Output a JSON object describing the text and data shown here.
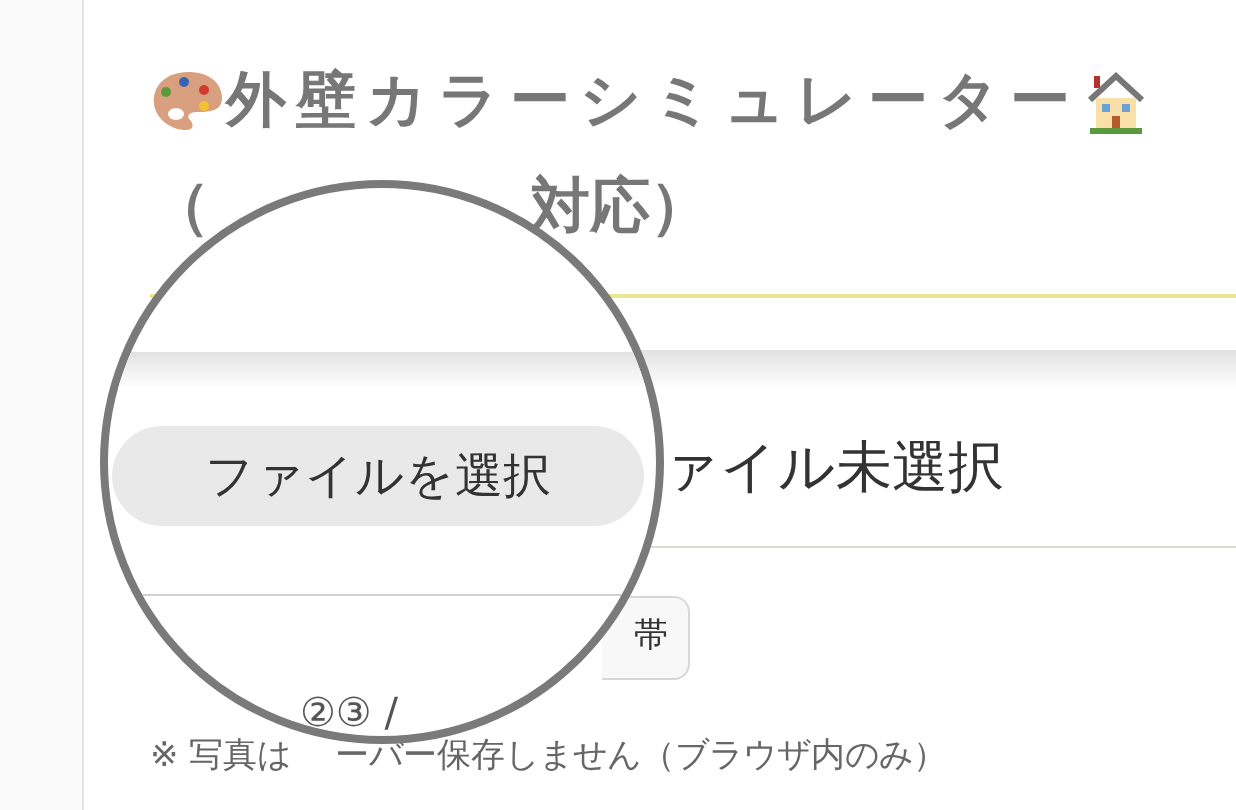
{
  "title": {
    "text": "外壁カラーシミュレーター",
    "line2_start": "（",
    "line2_end": "対応）"
  },
  "file_input": {
    "status": "ァイル未選択"
  },
  "chip": {
    "label": "帯"
  },
  "steps": {
    "text": "②③ /"
  },
  "note": {
    "start": "※ 写真は",
    "end": "ーバー保存しません（ブラウザ内のみ）"
  },
  "magnifier": {
    "button": "ファイルを選択"
  }
}
